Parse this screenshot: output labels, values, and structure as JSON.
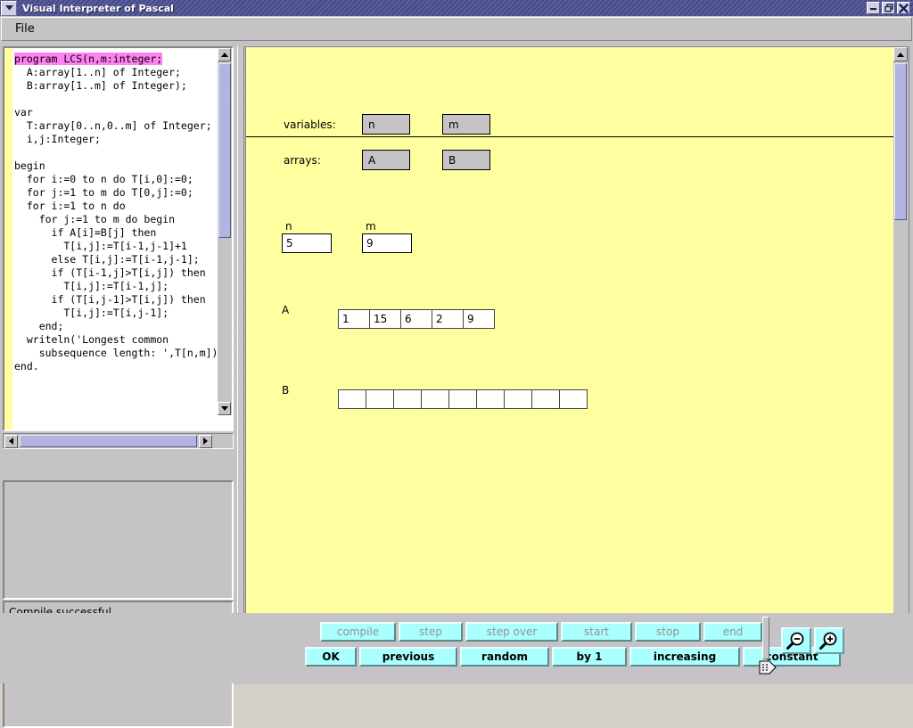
{
  "window": {
    "title": "Visual Interpreter of Pascal",
    "menu_icon": "chevron-down-icon",
    "minimize_label": "–",
    "restore_label": "❐",
    "close_label": "✖"
  },
  "menubar": {
    "file_label": "File"
  },
  "editor": {
    "code_before": "",
    "highlight_line": "program LCS(n,m:integer;",
    "code_after": "\n  A:array[1..n] of Integer;\n  B:array[1..m] of Integer);\n\nvar\n  T:array[0..n,0..m] of Integer;\n  i,j:Integer;\n\nbegin\n  for i:=0 to n do T[i,0]:=0;\n  for j:=1 to m do T[0,j]:=0;\n  for i:=1 to n do\n    for j:=1 to m do begin\n      if A[i]=B[j] then\n        T[i,j]:=T[i-1,j-1]+1\n      else T[i,j]:=T[i-1,j-1];\n      if (T[i-1,j]>T[i,j]) then\n        T[i,j]:=T[i-1,j];\n      if (T[i,j-1]>T[i,j]) then\n        T[i,j]:=T[i,j-1];\n    end;\n  writeln('Longest common\n    subsequence length: ',T[n,m])\nend."
  },
  "output_panel": {
    "content": ""
  },
  "status_panel": {
    "message": "Compile successful"
  },
  "inspector": {
    "variables_label": "variables:",
    "arrays_label": "arrays:",
    "variable_buttons": [
      {
        "label": "n"
      },
      {
        "label": "m"
      }
    ],
    "array_buttons": [
      {
        "label": "A"
      },
      {
        "label": "B"
      }
    ]
  },
  "values": {
    "scalars": [
      {
        "name": "n",
        "value": "5"
      },
      {
        "name": "m",
        "value": "9"
      }
    ],
    "arrays": [
      {
        "name": "A",
        "cells": [
          "1",
          "15",
          "6",
          "2",
          "9"
        ]
      },
      {
        "name": "B",
        "cells": [
          "",
          "",
          "",
          "",
          "",
          "",
          "",
          "",
          ""
        ]
      }
    ]
  },
  "toolbar": {
    "exec_buttons": [
      {
        "label": "compile",
        "enabled": false
      },
      {
        "label": "step",
        "enabled": false
      },
      {
        "label": "step over",
        "enabled": false
      },
      {
        "label": "start",
        "enabled": false
      },
      {
        "label": "stop",
        "enabled": false
      },
      {
        "label": "end",
        "enabled": false
      }
    ],
    "input_buttons": [
      {
        "label": "OK",
        "enabled": true
      },
      {
        "label": "previous",
        "enabled": true
      },
      {
        "label": "random",
        "enabled": true
      },
      {
        "label": "by 1",
        "enabled": true
      },
      {
        "label": "increasing",
        "enabled": true
      },
      {
        "label": "constant",
        "enabled": true
      }
    ],
    "zoom_out_icon": "zoom-out-icon",
    "zoom_in_icon": "zoom-in-icon"
  },
  "colors": {
    "titlebar": "#464b86",
    "canvas_yellow": "#ffffa0",
    "button_cyan": "#aaffff",
    "highlight_magenta": "#ff80f0",
    "face_gray": "#c6c3c6"
  }
}
